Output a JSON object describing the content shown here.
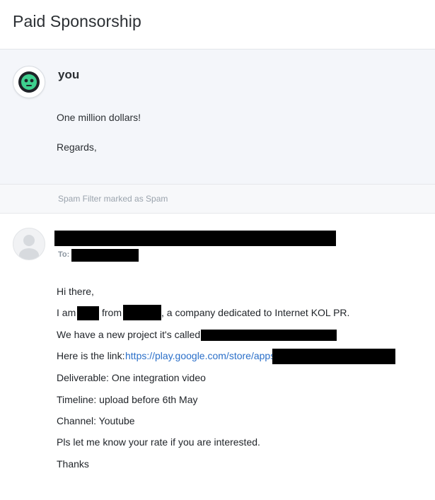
{
  "header": {
    "title": "Paid Sponsorship"
  },
  "reply": {
    "author": "you",
    "lines": [
      "One million dollars!",
      "Regards,"
    ],
    "avatar_colors": {
      "ring": "#1f2328",
      "face": "#3ecf8e"
    }
  },
  "spam_notice": "Spam Filter marked as Spam",
  "message": {
    "to_label": "To:",
    "greeting": "Hi there,",
    "intro": {
      "i_am": "I am",
      "from": "from",
      "company_desc": ", a company dedicated to Internet KOL PR."
    },
    "project_line": "We have a new project it's called",
    "link_line": {
      "prefix": "Here is the link:",
      "url_text": "https://play.google.com/store/apps"
    },
    "deliverable": "Deliverable: One integration video",
    "timeline": "Timeline: upload before 6th May",
    "channel": "Channel: Youtube",
    "rate_request": "Pls let me know your rate if you are interested.",
    "closing": "Thanks"
  },
  "colors": {
    "link": "#2a6fc9",
    "redaction": "#000000",
    "reply_background": "#f4f6fa"
  }
}
